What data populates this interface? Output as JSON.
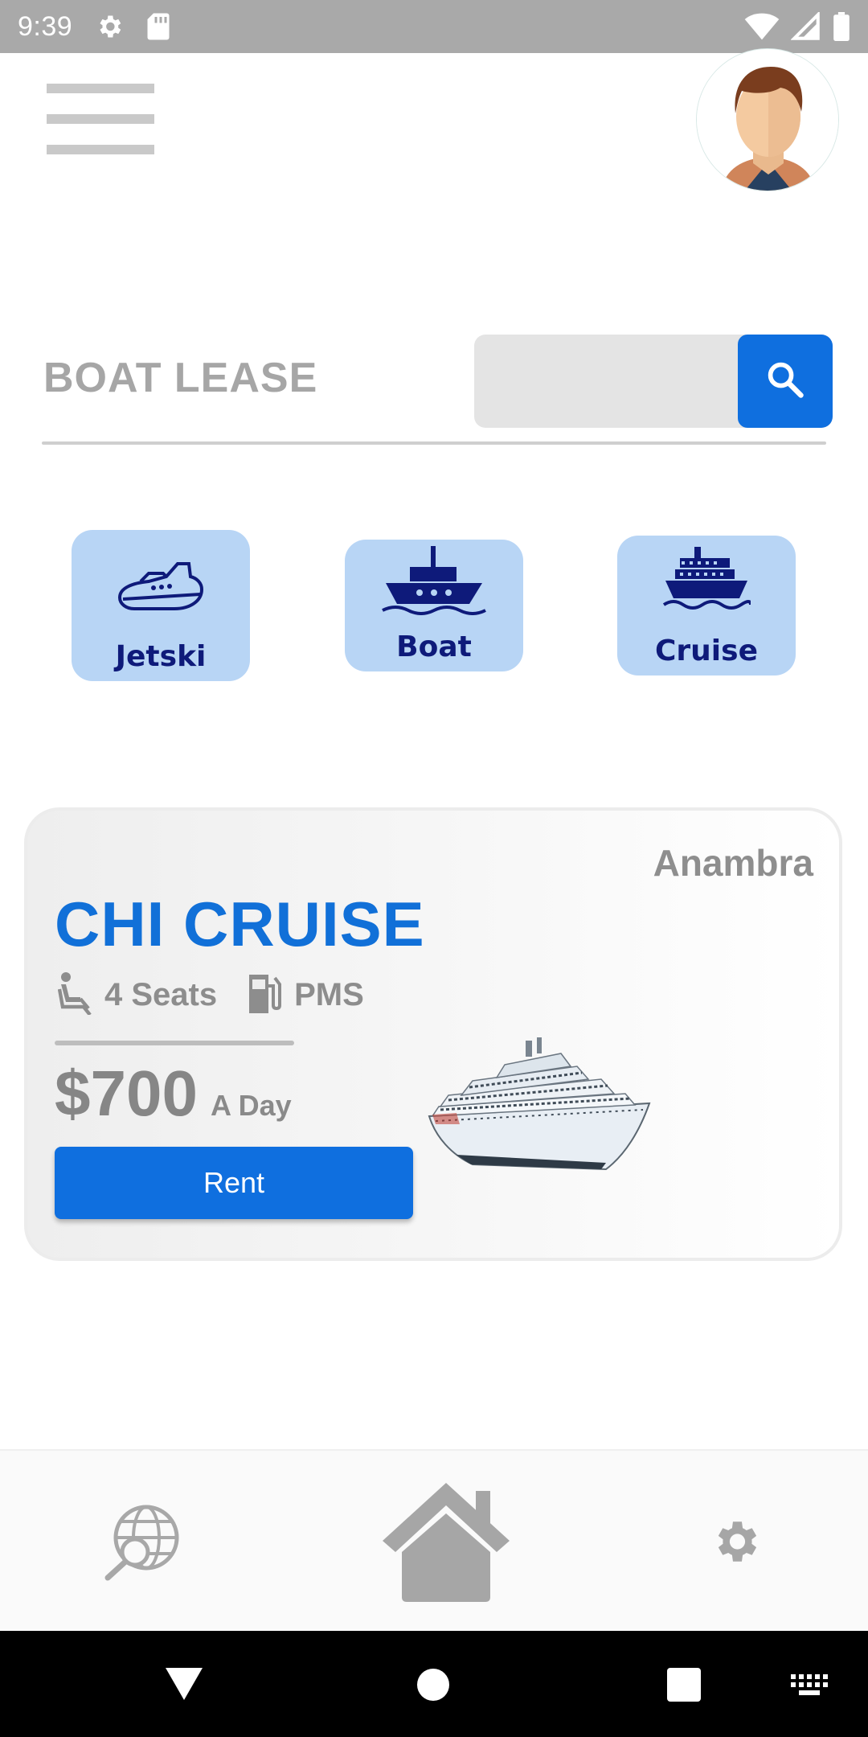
{
  "status_bar": {
    "time": "9:39",
    "icons": [
      "settings-icon",
      "sd-card-icon",
      "wifi-icon",
      "signal-icon",
      "battery-icon"
    ]
  },
  "header": {
    "menu_icon": "hamburger-menu-icon",
    "avatar_icon": "user-avatar"
  },
  "search": {
    "brand": "BOAT LEASE",
    "placeholder": "",
    "value": "",
    "button_icon": "search-icon"
  },
  "categories": [
    {
      "label": "Jetski",
      "icon": "jetski-icon"
    },
    {
      "label": "Boat",
      "icon": "boat-icon"
    },
    {
      "label": "Cruise",
      "icon": "cruise-ship-icon"
    }
  ],
  "listing": {
    "location": "Anambra",
    "name": "CHI CRUISE",
    "seats": "4 Seats",
    "fuel": "PMS",
    "price": "$700",
    "price_unit": "A Day",
    "rent_label": "Rent"
  },
  "bottom_nav": {
    "items": [
      {
        "name": "explore",
        "icon": "globe-search-icon"
      },
      {
        "name": "home",
        "icon": "home-icon"
      },
      {
        "name": "settings",
        "icon": "gear-icon"
      }
    ]
  },
  "system_nav": [
    "back-icon",
    "home-circle-icon",
    "recents-icon",
    "keyboard-icon"
  ],
  "colors": {
    "accent": "#0f6fdf",
    "category_bg": "#b8d5f5",
    "category_text": "#0e1a7a",
    "status_bar": "#a9a9a9"
  }
}
